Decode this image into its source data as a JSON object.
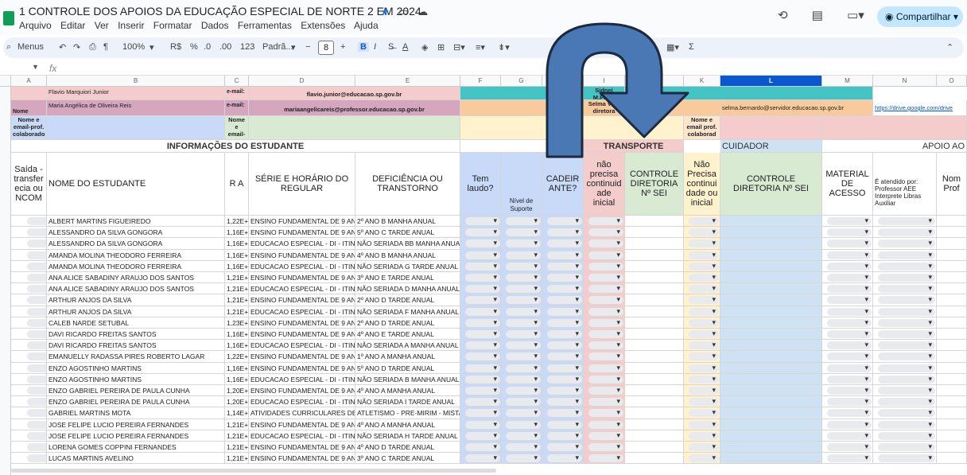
{
  "app": {
    "doc_title": "1 CONTROLE DOS APOIOS DA EDUCAÇÃO ESPECIAL DE NORTE 2 EM 2024",
    "menu": [
      "Arquivo",
      "Editar",
      "Ver",
      "Inserir",
      "Formatar",
      "Dados",
      "Ferramentas",
      "Extensões",
      "Ajuda"
    ],
    "share_label": "Compartilhar"
  },
  "toolbar": {
    "menus_label": "Menus",
    "zoom": "100%",
    "currency": "R$",
    "percent": "%",
    "dec_less": ".0",
    "dec_more": ".00",
    "format_123": "123",
    "font": "Padrã...",
    "font_size": "8",
    "bold": "B",
    "italic": "I",
    "sigma": "Σ"
  },
  "formula": {
    "fx": "fx"
  },
  "columns": [
    "A",
    "B",
    "C",
    "D",
    "E",
    "F",
    "G",
    "H",
    "I",
    "J",
    "K",
    "L",
    "M",
    "N",
    "O"
  ],
  "active_column": "L",
  "top_rows": {
    "r1": {
      "b": "Flavio Marquiori Junior",
      "c": "e-mail:",
      "d": "flavio.junior@educacao.sp.gov.br",
      "i": "Sidnei M.Parra"
    },
    "r2": {
      "a": "Nome",
      "b": "Maria Angélica de Oliveira Reis",
      "c": "e-mail:",
      "d": "mariaangelicareis@professor.educacao.sp.gov.br",
      "i": "Selma Vice diretora",
      "l": "selma.bernardo@servidor.educacao.sp.gov.br",
      "n": "https://drive.google.com/drive"
    },
    "r3": {
      "a": "Nome e email-prof. colaborado",
      "c": "Nome e email-",
      "k": "Nome e email prof. colaborad"
    }
  },
  "section_headers": {
    "info": "INFORMAÇÕES DO ESTUDANTE",
    "transporte": "TRANSPORTE",
    "cuidador": "CUIDADOR",
    "apoio": "APOIO AO"
  },
  "col_headers": {
    "a": "Saída - transfer ecia ou NCOM",
    "b": "NOME DO ESTUDANTE",
    "c": "R A",
    "d": "SÉRIE E HORÁRIO DO REGULAR",
    "e": "DEFICIÊNCIA OU TRANSTORNO",
    "f": "Tem laudo?",
    "g": "Nível de Suporte",
    "h": "CADEIR ANTE?",
    "i": "não precisa continuid ade inicial",
    "j": "CONTROLE DIRETORIA Nº SEI",
    "k": "Não Precisa continui dade ou inicial",
    "l": "CONTROLE DIRETORIA Nº SEI",
    "m": "MATERIAL DE ACESSO",
    "n": "É atendido por: Professor AEE Interprete Libras Auxiliar",
    "o": "Nom Prof"
  },
  "students": [
    {
      "name": "ALBERT MARTINS FIGUEIREDO",
      "ra": "1,22E+",
      "serie": "ENSINO FUNDAMENTAL DE 9 AN",
      "def": "2º ANO B MANHA ANUAL"
    },
    {
      "name": "ALESSANDRO DA SILVA GONGORA",
      "ra": "1,16E+",
      "serie": "ENSINO FUNDAMENTAL DE 9 AN",
      "def": "5º ANO C TARDE ANUAL"
    },
    {
      "name": "ALESSANDRO DA SILVA GONGORA",
      "ra": "1,16E+",
      "serie": "EDUCACAO ESPECIAL - DI - ITINEI",
      "def": "NÃO SERIADA BB MANHA ANUA"
    },
    {
      "name": "AMANDA MOLINA THEODORO FERREIRA",
      "ra": "1,16E+",
      "serie": "ENSINO FUNDAMENTAL DE 9 AN",
      "def": "4º ANO B MANHA ANUAL"
    },
    {
      "name": "AMANDA MOLINA THEODORO FERREIRA",
      "ra": "1,16E+",
      "serie": "EDUCACAO ESPECIAL - DI - ITINEI",
      "def": "NÃO SERIADA G TARDE ANUAL"
    },
    {
      "name": "ANA ALICE SABADINY ARAUJO DOS SANTOS",
      "ra": "1,21E+",
      "serie": "ENSINO FUNDAMENTAL DE 9 AN",
      "def": "3º ANO E TARDE ANUAL"
    },
    {
      "name": "ANA ALICE SABADINY ARAUJO DOS SANTOS",
      "ra": "1,21E+",
      "serie": "EDUCACAO ESPECIAL - DI - ITINEI",
      "def": "NÃO SERIADA D MANHA ANUAL"
    },
    {
      "name": "ARTHUR ANJOS DA SILVA",
      "ra": "1,21E+",
      "serie": "ENSINO FUNDAMENTAL DE 9 AN",
      "def": "2º ANO D TARDE ANUAL"
    },
    {
      "name": "ARTHUR ANJOS DA SILVA",
      "ra": "1,21E+",
      "serie": "EDUCACAO ESPECIAL - DI - ITINEI",
      "def": "NÃO SERIADA F MANHA ANUAL"
    },
    {
      "name": "CALEB NARDE SETUBAL",
      "ra": "1,23E+",
      "serie": "ENSINO FUNDAMENTAL DE 9 AN",
      "def": "2º ANO D TARDE ANUAL"
    },
    {
      "name": "DAVI RICARDO FREITAS SANTOS",
      "ra": "1,16E+",
      "serie": "ENSINO FUNDAMENTAL DE 9 AN",
      "def": "4º ANO E TARDE ANUAL"
    },
    {
      "name": "DAVI RICARDO FREITAS SANTOS",
      "ra": "1,16E+",
      "serie": "EDUCACAO ESPECIAL - DI - ITINEI",
      "def": "NÃO SERIADA A MANHA ANUAL"
    },
    {
      "name": "EMANUELLY RADASSA PIRES ROBERTO LAGAR",
      "ra": "1,22E+",
      "serie": "ENSINO FUNDAMENTAL DE 9 AN",
      "def": "1º ANO A MANHA ANUAL"
    },
    {
      "name": "ENZO AGOSTINHO MARTINS",
      "ra": "1,16E+",
      "serie": "ENSINO FUNDAMENTAL DE 9 AN",
      "def": "5º ANO D TARDE ANUAL"
    },
    {
      "name": "ENZO AGOSTINHO MARTINS",
      "ra": "1,16E+",
      "serie": "EDUCACAO ESPECIAL - DI - ITINEI",
      "def": "NÃO SERIADA B MANHA ANUAL"
    },
    {
      "name": "ENZO GABRIEL PEREIRA DE PAULA CUNHA",
      "ra": "1,20E+",
      "serie": "ENSINO FUNDAMENTAL DE 9 AN",
      "def": "4º ANO A MANHA ANUAL"
    },
    {
      "name": "ENZO GABRIEL PEREIRA DE PAULA CUNHA",
      "ra": "1,20E+",
      "serie": "EDUCACAO ESPECIAL - DI - ITINEI",
      "def": "NÃO SERIADA I TARDE ANUAL"
    },
    {
      "name": "GABRIEL MARTINS MOTA",
      "ra": "1,14E+",
      "serie": "ATIVIDADES CURRICULARES DESE",
      "def": "ATLETISMO - PRE-MIRIM - MISTA"
    },
    {
      "name": "JOSE FELIPE LUCIO PEREIRA FERNANDES",
      "ra": "1,21E+",
      "serie": "ENSINO FUNDAMENTAL DE 9 AN",
      "def": "4º ANO A MANHA ANUAL"
    },
    {
      "name": "JOSE FELIPE LUCIO PEREIRA FERNANDES",
      "ra": "1,21E+",
      "serie": "EDUCACAO ESPECIAL - DI - ITINEI",
      "def": "NÃO SERIADA H TARDE ANUAL"
    },
    {
      "name": "LORENA GOMES COPPINI FERNANDES",
      "ra": "1,21E+",
      "serie": "ENSINO FUNDAMENTAL DE 9 AN",
      "def": "4º ANO D TARDE ANUAL"
    },
    {
      "name": "LUCAS MARTINS AVELINO",
      "ra": "1,21E+",
      "serie": "ENSINO FUNDAMENTAL DE 9 AN",
      "def": "3º ANO C TARDE ANUAL"
    }
  ],
  "colors": {
    "accent": "#0b57d0",
    "arrow": "#4a78b5",
    "share": "#c2e7ff"
  }
}
